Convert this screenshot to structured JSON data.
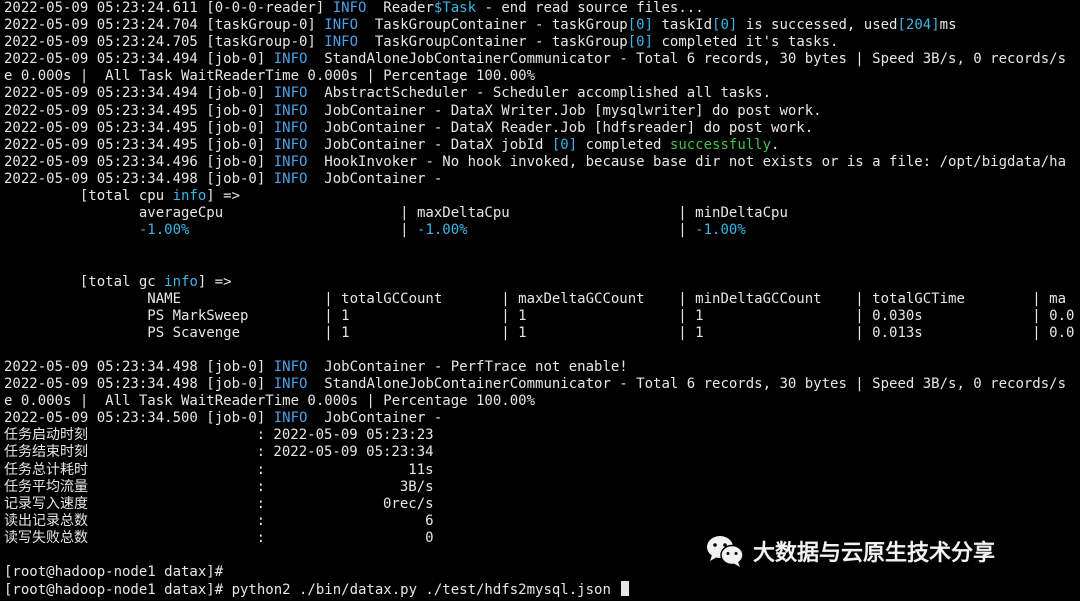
{
  "lines": [
    {
      "parts": [
        [
          "2022-05-09 05:23:24.611 [0-0-0-reader] ",
          ""
        ],
        [
          "INFO",
          "info"
        ],
        [
          "  Reader",
          ""
        ],
        [
          "$Task",
          "cyan"
        ],
        [
          " - end read source files...",
          ""
        ]
      ]
    },
    {
      "parts": [
        [
          "2022-05-09 05:23:24.704 [taskGroup-0] ",
          ""
        ],
        [
          "INFO",
          "info"
        ],
        [
          "  TaskGroupContainer - taskGroup",
          ""
        ],
        [
          "[0]",
          "cyan"
        ],
        [
          " taskId",
          ""
        ],
        [
          "[0]",
          "cyan"
        ],
        [
          " is successed, used",
          ""
        ],
        [
          "[204]",
          "cyan"
        ],
        [
          "ms",
          ""
        ]
      ]
    },
    {
      "parts": [
        [
          "2022-05-09 05:23:24.705 [taskGroup-0] ",
          ""
        ],
        [
          "INFO",
          "info"
        ],
        [
          "  TaskGroupContainer - taskGroup",
          ""
        ],
        [
          "[0]",
          "cyan"
        ],
        [
          " completed it's tasks.",
          ""
        ]
      ]
    },
    {
      "parts": [
        [
          "2022-05-09 05:23:34.494 [job-0] ",
          ""
        ],
        [
          "INFO",
          "info"
        ],
        [
          "  StandAloneJobContainerCommunicator - Total 6 records, 30 bytes | Speed 3B/s, 0 records/s",
          ""
        ]
      ]
    },
    {
      "parts": [
        [
          "e 0.000s |  All Task WaitReaderTime 0.000s | Percentage 100.00%",
          ""
        ]
      ]
    },
    {
      "parts": [
        [
          "2022-05-09 05:23:34.494 [job-0] ",
          ""
        ],
        [
          "INFO",
          "info"
        ],
        [
          "  AbstractScheduler - Scheduler accomplished all tasks.",
          ""
        ]
      ]
    },
    {
      "parts": [
        [
          "2022-05-09 05:23:34.495 [job-0] ",
          ""
        ],
        [
          "INFO",
          "info"
        ],
        [
          "  JobContainer - DataX Writer.Job [mysqlwriter] do post work.",
          ""
        ]
      ]
    },
    {
      "parts": [
        [
          "2022-05-09 05:23:34.495 [job-0] ",
          ""
        ],
        [
          "INFO",
          "info"
        ],
        [
          "  JobContainer - DataX Reader.Job [hdfsreader] do post work.",
          ""
        ]
      ]
    },
    {
      "parts": [
        [
          "2022-05-09 05:23:34.495 [job-0] ",
          ""
        ],
        [
          "INFO",
          "info"
        ],
        [
          "  JobContainer - DataX jobId ",
          ""
        ],
        [
          "[0]",
          "cyan"
        ],
        [
          " completed ",
          ""
        ],
        [
          "successfully",
          "green"
        ],
        [
          ".",
          ""
        ]
      ]
    },
    {
      "parts": [
        [
          "2022-05-09 05:23:34.496 [job-0] ",
          ""
        ],
        [
          "INFO",
          "info"
        ],
        [
          "  HookInvoker - No hook invoked, because base dir not exists or is a file: /opt/bigdata/ha",
          ""
        ]
      ]
    },
    {
      "parts": [
        [
          "2022-05-09 05:23:34.498 [job-0] ",
          ""
        ],
        [
          "INFO",
          "info"
        ],
        [
          "  JobContainer -",
          ""
        ]
      ]
    },
    {
      "parts": [
        [
          "         [total cpu ",
          ""
        ],
        [
          "info",
          "cyan"
        ],
        [
          "] =>",
          ""
        ]
      ]
    },
    {
      "parts": [
        [
          "                averageCpu                     | maxDeltaCpu                    | minDeltaCpu",
          ""
        ]
      ]
    },
    {
      "parts": [
        [
          "                ",
          ""
        ],
        [
          "-1.00%",
          "cyan"
        ],
        [
          "                         | ",
          ""
        ],
        [
          "-1.00%",
          "cyan"
        ],
        [
          "                         | ",
          ""
        ],
        [
          "-1.00%",
          "cyan"
        ]
      ]
    },
    {
      "parts": [
        [
          "",
          ""
        ]
      ]
    },
    {
      "parts": [
        [
          "",
          ""
        ]
      ]
    },
    {
      "parts": [
        [
          "         [total gc ",
          ""
        ],
        [
          "info",
          "cyan"
        ],
        [
          "] =>",
          ""
        ]
      ]
    },
    {
      "parts": [
        [
          "                 NAME                 | totalGCCount       | maxDeltaGCCount    | minDeltaGCCount    | totalGCTime        | ma",
          ""
        ]
      ]
    },
    {
      "parts": [
        [
          "                 PS MarkSweep         | 1                  | 1                  | 1                  | 0.030s             | 0.0",
          ""
        ]
      ]
    },
    {
      "parts": [
        [
          "                 PS Scavenge          | 1                  | 1                  | 1                  | 0.013s             | 0.0",
          ""
        ]
      ]
    },
    {
      "parts": [
        [
          "",
          ""
        ]
      ]
    },
    {
      "parts": [
        [
          "2022-05-09 05:23:34.498 [job-0] ",
          ""
        ],
        [
          "INFO",
          "info"
        ],
        [
          "  JobContainer - PerfTrace not enable!",
          ""
        ]
      ]
    },
    {
      "parts": [
        [
          "2022-05-09 05:23:34.498 [job-0] ",
          ""
        ],
        [
          "INFO",
          "info"
        ],
        [
          "  StandAloneJobContainerCommunicator - Total 6 records, 30 bytes | Speed 3B/s, 0 records/s",
          ""
        ]
      ]
    },
    {
      "parts": [
        [
          "e 0.000s |  All Task WaitReaderTime 0.000s | Percentage 100.00%",
          ""
        ]
      ]
    },
    {
      "parts": [
        [
          "2022-05-09 05:23:34.500 [job-0] ",
          ""
        ],
        [
          "INFO",
          "info"
        ],
        [
          "  JobContainer -",
          ""
        ]
      ]
    },
    {
      "parts": [
        [
          "任务启动时刻                    : 2022-05-09 05:23:23",
          ""
        ]
      ]
    },
    {
      "parts": [
        [
          "任务结束时刻                    : 2022-05-09 05:23:34",
          ""
        ]
      ]
    },
    {
      "parts": [
        [
          "任务总计耗时                    :                 11s",
          ""
        ]
      ]
    },
    {
      "parts": [
        [
          "任务平均流量                    :                3B/s",
          ""
        ]
      ]
    },
    {
      "parts": [
        [
          "记录写入速度                    :              0rec/s",
          ""
        ]
      ]
    },
    {
      "parts": [
        [
          "读出记录总数                    :                   6",
          ""
        ]
      ]
    },
    {
      "parts": [
        [
          "读写失败总数                    :                   0",
          ""
        ]
      ]
    },
    {
      "parts": [
        [
          "",
          ""
        ]
      ]
    },
    {
      "parts": [
        [
          "[root@hadoop-node1 datax]#",
          ""
        ]
      ]
    },
    {
      "parts": [
        [
          "[root@hadoop-node1 datax]# python2 ./bin/datax.py ./test/hdfs2mysql.json ",
          ""
        ]
      ],
      "cursor": true
    }
  ],
  "watermark": {
    "icon": "wechat-icon",
    "text": "大数据与云原生技术分享"
  }
}
